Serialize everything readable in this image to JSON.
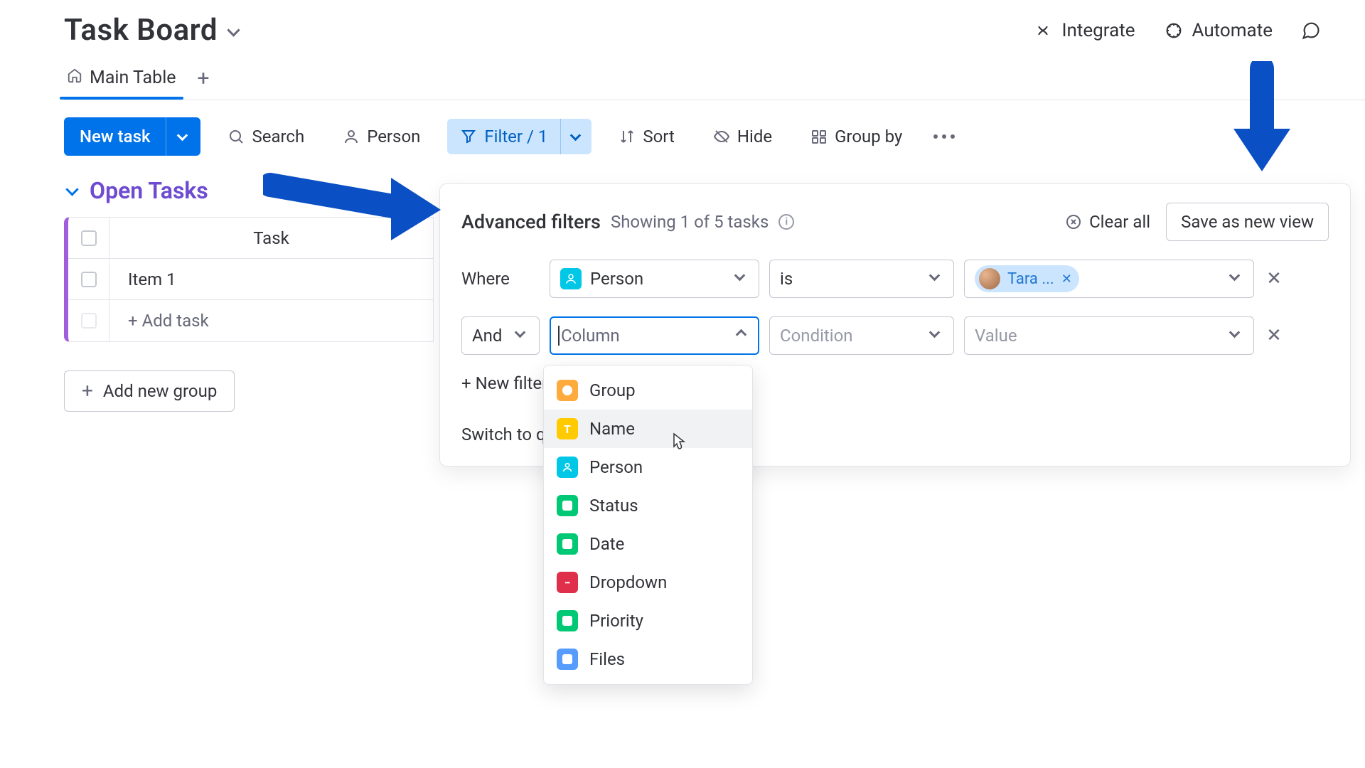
{
  "header": {
    "board_title": "Task Board",
    "actions": {
      "integrate": "Integrate",
      "automate": "Automate"
    }
  },
  "tabs": {
    "main": "Main Table"
  },
  "toolbar": {
    "new_task": "New task",
    "search": "Search",
    "person": "Person",
    "filter": "Filter / 1",
    "sort": "Sort",
    "hide": "Hide",
    "group_by": "Group by"
  },
  "group": {
    "title": "Open Tasks",
    "column_header": "Task",
    "rows": {
      "0": {
        "name": "Item 1"
      }
    },
    "add_task": "+ Add task",
    "add_group": "Add new group"
  },
  "filters": {
    "title": "Advanced filters",
    "subtitle": "Showing 1 of 5 tasks",
    "clear_all": "Clear all",
    "save_view": "Save as new view",
    "where_label": "Where",
    "and_label": "And",
    "row1": {
      "column": "Person",
      "condition": "is",
      "value_chip": "Tara ..."
    },
    "row2": {
      "column_placeholder": "Column",
      "condition_placeholder": "Condition",
      "value_placeholder": "Value"
    },
    "new_filter": "+ New filter",
    "switch_quick": "Switch to quick filters"
  },
  "dropdown": {
    "items": {
      "0": {
        "label": "Group"
      },
      "1": {
        "label": "Name"
      },
      "2": {
        "label": "Person"
      },
      "3": {
        "label": "Status"
      },
      "4": {
        "label": "Date"
      },
      "5": {
        "label": "Dropdown"
      },
      "6": {
        "label": "Priority"
      },
      "7": {
        "label": "Files"
      }
    }
  }
}
